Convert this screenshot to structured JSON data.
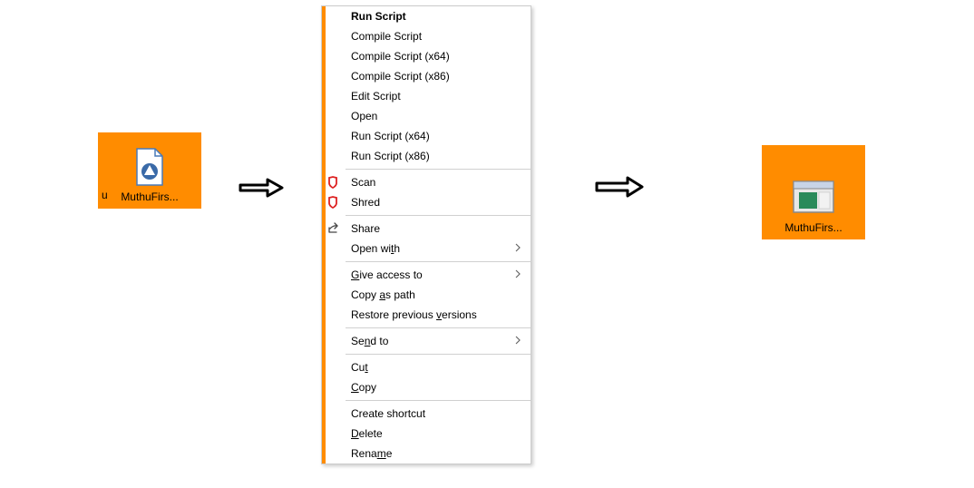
{
  "left_tile": {
    "label": "MuthuFirs...",
    "fragment_u": "u"
  },
  "right_tile": {
    "label": "MuthuFirs..."
  },
  "context_menu": {
    "items": [
      {
        "label": "Run Script",
        "bold": true
      },
      {
        "label": "Compile Script"
      },
      {
        "label": "Compile Script (x64)"
      },
      {
        "label": "Compile Script (x86)"
      },
      {
        "label": "Edit Script"
      },
      {
        "label": "Open"
      },
      {
        "label": "Run Script (x64)"
      },
      {
        "label": "Run Script (x86)"
      },
      {
        "separator": true
      },
      {
        "label": "Scan",
        "icon": "shield-red"
      },
      {
        "label": "Shred",
        "icon": "shield-red"
      },
      {
        "separator": true
      },
      {
        "label": "Share",
        "icon": "share"
      },
      {
        "label": "Open with",
        "u_letter": 7,
        "submenu": true
      },
      {
        "separator": true
      },
      {
        "label": "Give access to",
        "u_letter": 0,
        "submenu": true
      },
      {
        "label": "Copy as path",
        "u_letter": 5
      },
      {
        "label": "Restore previous versions",
        "u_letter": 17
      },
      {
        "separator": true
      },
      {
        "label": "Send to",
        "u_letter": 2,
        "submenu": true
      },
      {
        "separator": true
      },
      {
        "label": "Cut",
        "u_letter": 2
      },
      {
        "label": "Copy",
        "u_letter": 0
      },
      {
        "separator": true
      },
      {
        "label": "Create shortcut"
      },
      {
        "label": "Delete",
        "u_letter": 0
      },
      {
        "label": "Rename",
        "u_letter": 4
      }
    ]
  }
}
